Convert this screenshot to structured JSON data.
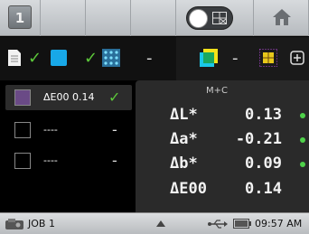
{
  "topbar": {
    "page_number": "1",
    "toggle_icon": "grid-icon",
    "home_icon": "home-icon"
  },
  "iconrow": {
    "items": [
      {
        "icon": "document-icon",
        "status": "✓"
      },
      {
        "icon": "blue-square-icon",
        "status": "✓"
      },
      {
        "icon": "dot-grid-icon",
        "status": "-"
      },
      {
        "icon": "yellow-cyan-square-icon",
        "status": "-"
      },
      {
        "icon": "color-grid-icon",
        "status": ""
      },
      {
        "icon": "crosshair-icon",
        "status": ""
      }
    ]
  },
  "list": {
    "rows": [
      {
        "swatch_color": "#6a4a86",
        "label": "ΔE00 0.14",
        "mark": "✓"
      },
      {
        "swatch_color": "",
        "label": "----",
        "mark": "-"
      },
      {
        "swatch_color": "",
        "label": "----",
        "mark": "-"
      }
    ]
  },
  "panel": {
    "title": "M+C",
    "metrics": [
      {
        "label": "ΔL*",
        "value": "0.13",
        "ok": true
      },
      {
        "label": "Δa*",
        "value": "-0.21",
        "ok": true
      },
      {
        "label": "Δb*",
        "value": "0.09",
        "ok": true
      },
      {
        "label": "ΔE00",
        "value": "0.14",
        "ok": false
      }
    ]
  },
  "status": {
    "job": "JOB 1",
    "time": "09:57 AM"
  },
  "colors": {
    "accent_green": "#5cc83a",
    "panel_bg": "#2a2a2a"
  }
}
